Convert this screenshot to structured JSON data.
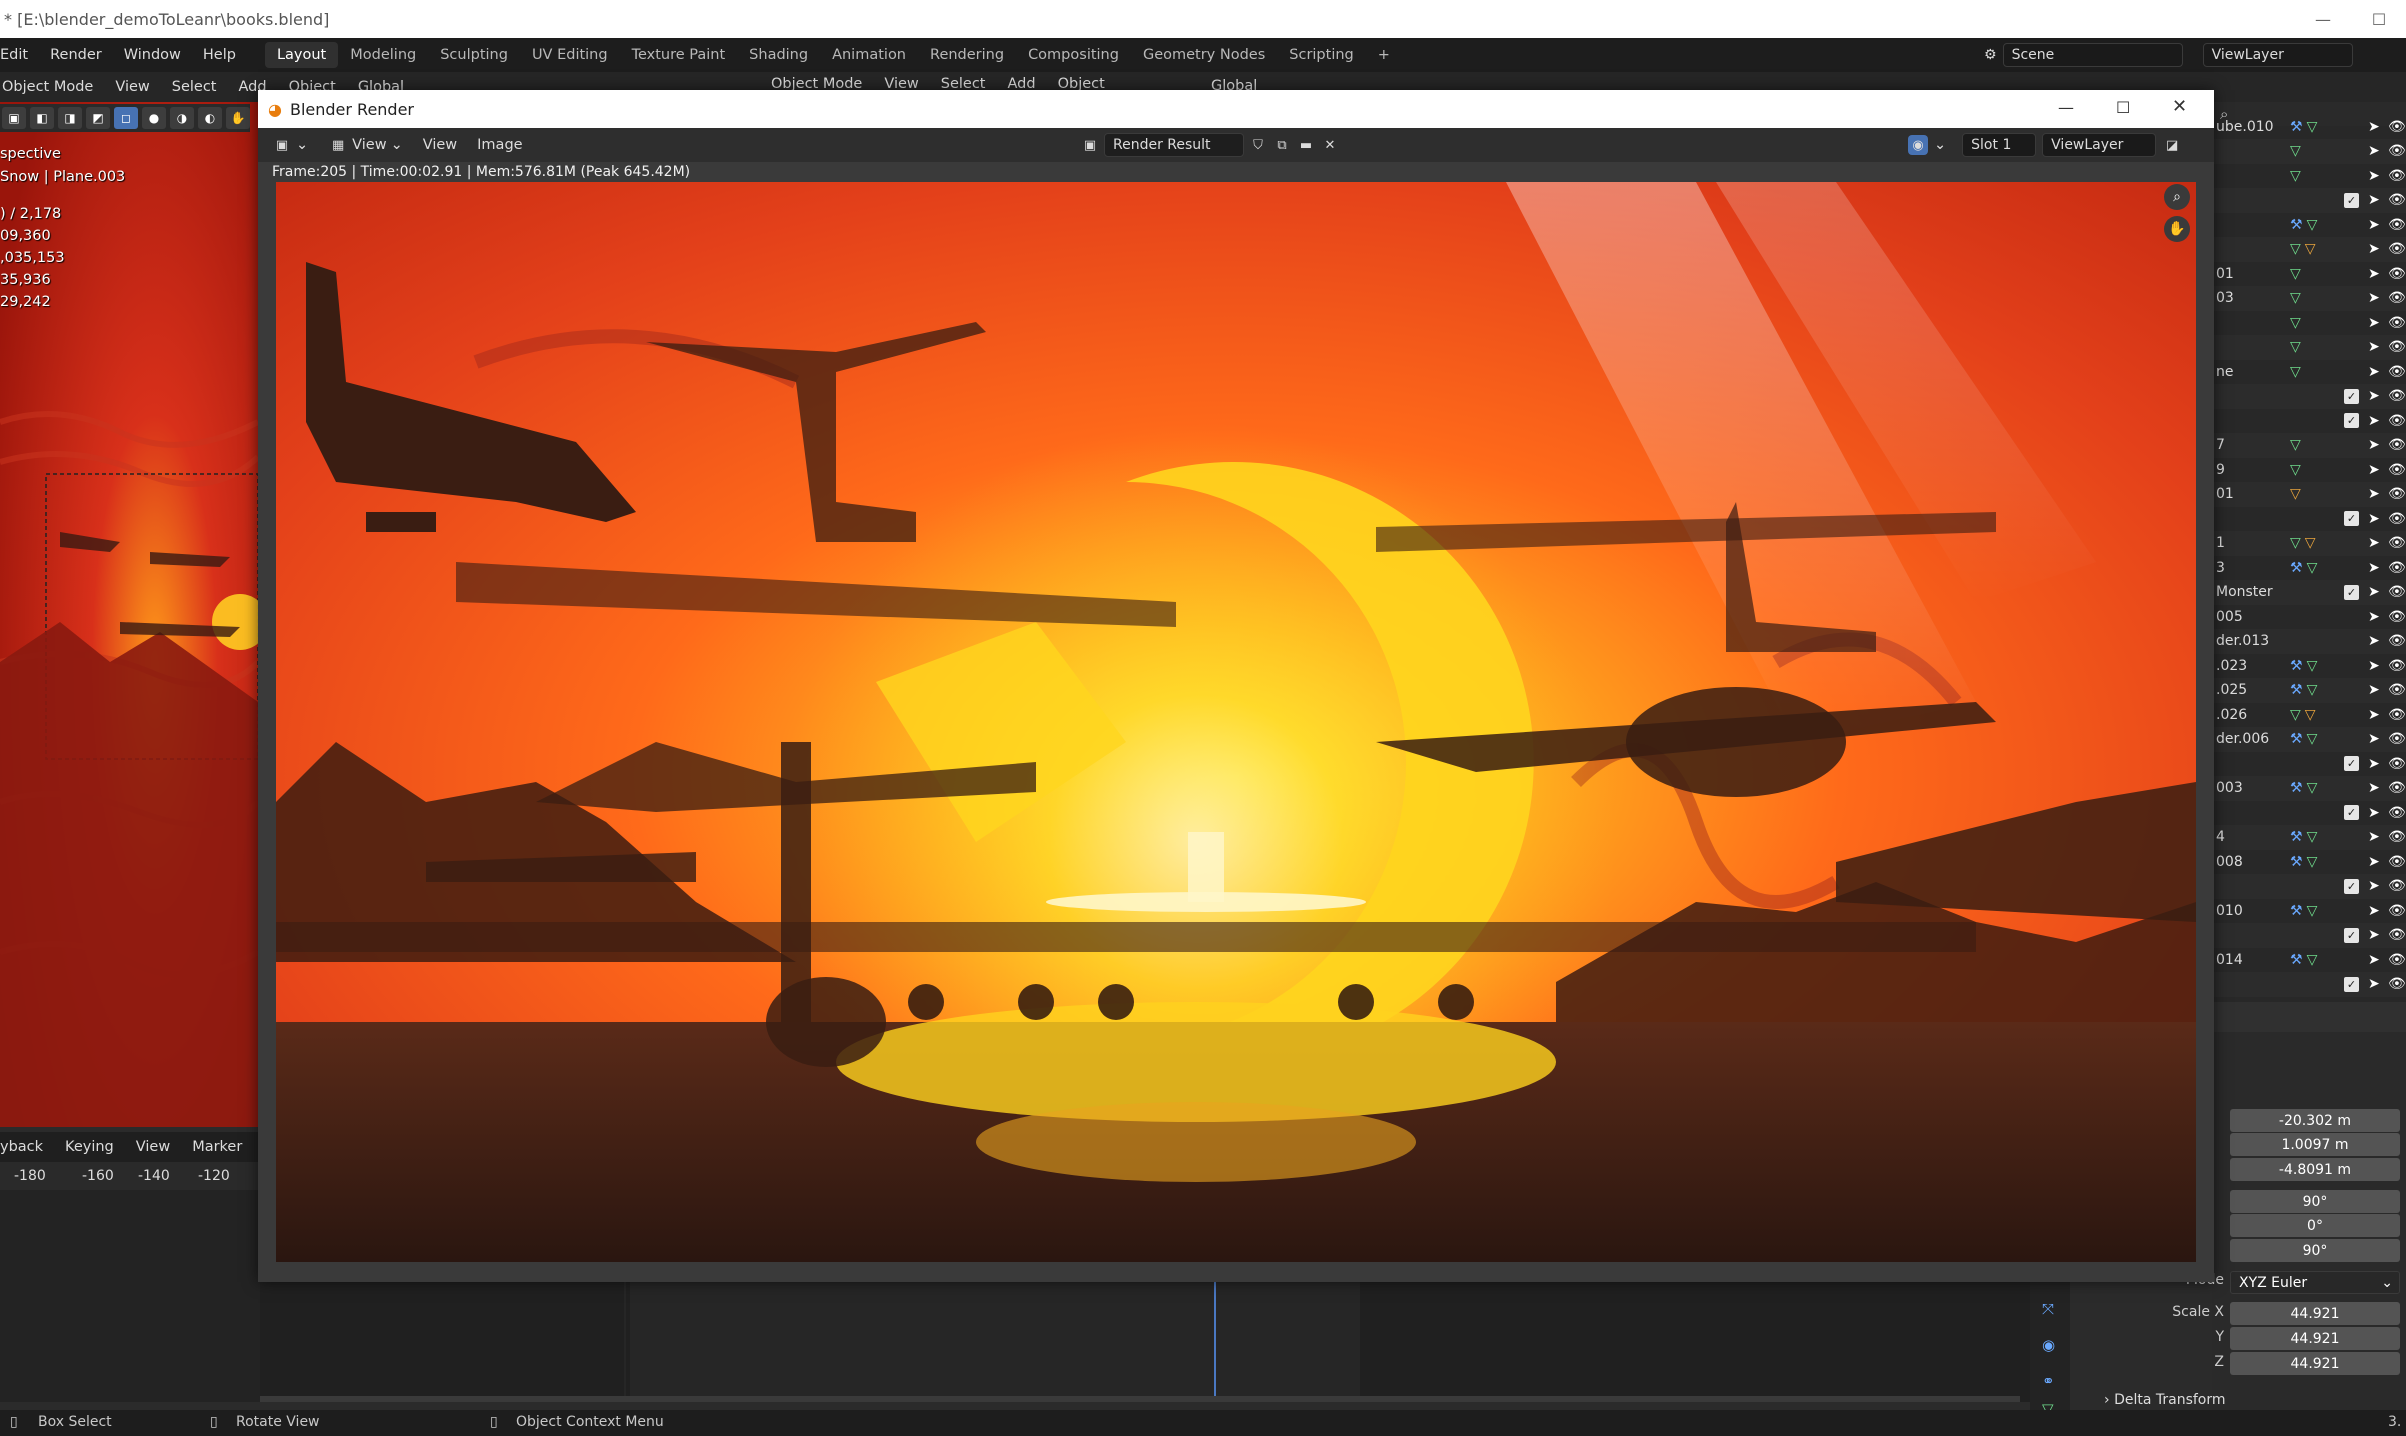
{
  "os_window": {
    "title": "* [E:\\blender_demoToLeanr\\books.blend]",
    "minimize": "—",
    "maximize": "☐"
  },
  "topbar": {
    "menus": [
      "Edit",
      "Render",
      "Window",
      "Help"
    ],
    "workspaces": [
      "Layout",
      "Modeling",
      "Sculpting",
      "UV Editing",
      "Texture Paint",
      "Shading",
      "Animation",
      "Rendering",
      "Compositing",
      "Geometry Nodes",
      "Scripting"
    ],
    "active_workspace": "Layout",
    "add_workspace": "+",
    "scene_label": "Scene",
    "viewlayer_label": "ViewLayer"
  },
  "viewport_header": {
    "mode": "Object Mode",
    "menus": [
      "View",
      "Select",
      "Add",
      "Object"
    ],
    "transform_orientation": "Global",
    "right_mode": "Object Mode",
    "right_menus": [
      "View",
      "Select",
      "Add",
      "Object"
    ],
    "right_orientation": "Global"
  },
  "viewport_overlay": {
    "view_name": "spective",
    "object_name": "Snow | Plane.003",
    "stats": [
      ") / 2,178",
      "09,360",
      ",035,153",
      "35,936",
      "29,242"
    ]
  },
  "timeline": {
    "menus": [
      "yback",
      "Keying",
      "View",
      "Marker"
    ],
    "ruler": [
      "-180",
      "-160",
      "-140",
      "-120"
    ]
  },
  "statusbar": {
    "items": [
      "Box Select",
      "Rotate View",
      "Object Context Menu"
    ],
    "version": "3."
  },
  "outliner": {
    "rows": [
      {
        "name": "ube.010",
        "icons": [
          "wrench",
          "tri-g"
        ],
        "check": false
      },
      {
        "name": "",
        "icons": [
          "tri-g"
        ],
        "check": false
      },
      {
        "name": "",
        "icons": [
          "tri-g"
        ],
        "check": false
      },
      {
        "name": "",
        "icons": [],
        "check": true
      },
      {
        "name": "",
        "icons": [
          "wrench",
          "tri-g"
        ],
        "check": false
      },
      {
        "name": "",
        "icons": [
          "tri-g",
          "tri-o"
        ],
        "check": false
      },
      {
        "name": "01",
        "icons": [
          "tri-g"
        ],
        "check": false
      },
      {
        "name": "03",
        "icons": [
          "tri-g"
        ],
        "check": false
      },
      {
        "name": "",
        "icons": [
          "tri-g"
        ],
        "check": false
      },
      {
        "name": "",
        "icons": [
          "tri-g"
        ],
        "check": false
      },
      {
        "name": "ne",
        "icons": [
          "tri-g"
        ],
        "check": false
      },
      {
        "name": "",
        "icons": [],
        "check": true
      },
      {
        "name": "",
        "icons": [],
        "check": true
      },
      {
        "name": "7",
        "icons": [
          "tri-g"
        ],
        "check": false
      },
      {
        "name": "9",
        "icons": [
          "tri-g"
        ],
        "check": false
      },
      {
        "name": "01",
        "icons": [
          "tri-o"
        ],
        "check": false
      },
      {
        "name": "",
        "icons": [],
        "check": true
      },
      {
        "name": "1",
        "icons": [
          "tri-g",
          "tri-o"
        ],
        "check": false
      },
      {
        "name": "3",
        "icons": [
          "wrench",
          "tri-g"
        ],
        "check": false
      },
      {
        "name": "Monster",
        "icons": [],
        "check": true
      },
      {
        "name": "005",
        "icons": [],
        "check": false
      },
      {
        "name": "der.013",
        "icons": [],
        "check": false
      },
      {
        "name": ".023",
        "icons": [
          "wrench",
          "tri-g"
        ],
        "check": false
      },
      {
        "name": ".025",
        "icons": [
          "wrench",
          "tri-g"
        ],
        "check": false
      },
      {
        "name": ".026",
        "icons": [
          "tri-g",
          "tri-o"
        ],
        "check": false
      },
      {
        "name": "der.006",
        "icons": [
          "wrench",
          "tri-g"
        ],
        "check": false
      },
      {
        "name": "",
        "icons": [],
        "check": true
      },
      {
        "name": "003",
        "icons": [
          "wrench",
          "tri-g"
        ],
        "check": false
      },
      {
        "name": "",
        "icons": [],
        "check": true
      },
      {
        "name": "4",
        "icons": [
          "wrench",
          "tri-g"
        ],
        "check": false
      },
      {
        "name": "008",
        "icons": [
          "wrench",
          "tri-g"
        ],
        "check": false
      },
      {
        "name": "",
        "icons": [],
        "check": true
      },
      {
        "name": "010",
        "icons": [
          "wrench",
          "tri-g"
        ],
        "check": false
      },
      {
        "name": "",
        "icons": [],
        "check": true
      },
      {
        "name": "014",
        "icons": [
          "wrench",
          "tri-g"
        ],
        "check": false
      },
      {
        "name": "",
        "icons": [],
        "check": true
      }
    ]
  },
  "properties": {
    "location": [
      "-20.302 m",
      "1.0097 m",
      "-4.8091 m"
    ],
    "rotation": [
      "90°",
      "0°",
      "90°"
    ],
    "mode_label": "Mode",
    "mode_value": "XYZ Euler",
    "scale_labels": [
      "Scale X",
      "Y",
      "Z"
    ],
    "scale": [
      "44.921",
      "44.921",
      "44.921"
    ],
    "delta_transform": "Delta Transform"
  },
  "render_window": {
    "title": "Blender Render",
    "header": {
      "menus": [
        "View",
        "View",
        "Image"
      ],
      "image_name": "Render Result",
      "slot": "Slot 1",
      "view_layer": "ViewLayer"
    },
    "info": "Frame:205 | Time:00:02.91 | Mem:576.81M (Peak 645.42M)"
  },
  "colors": {
    "sky_top": "#e6401a",
    "sky_mid": "#ff6a1a",
    "sun": "#ffd21e",
    "silhouette": "#3a1d12",
    "viewport_red": "#a81a0c"
  }
}
